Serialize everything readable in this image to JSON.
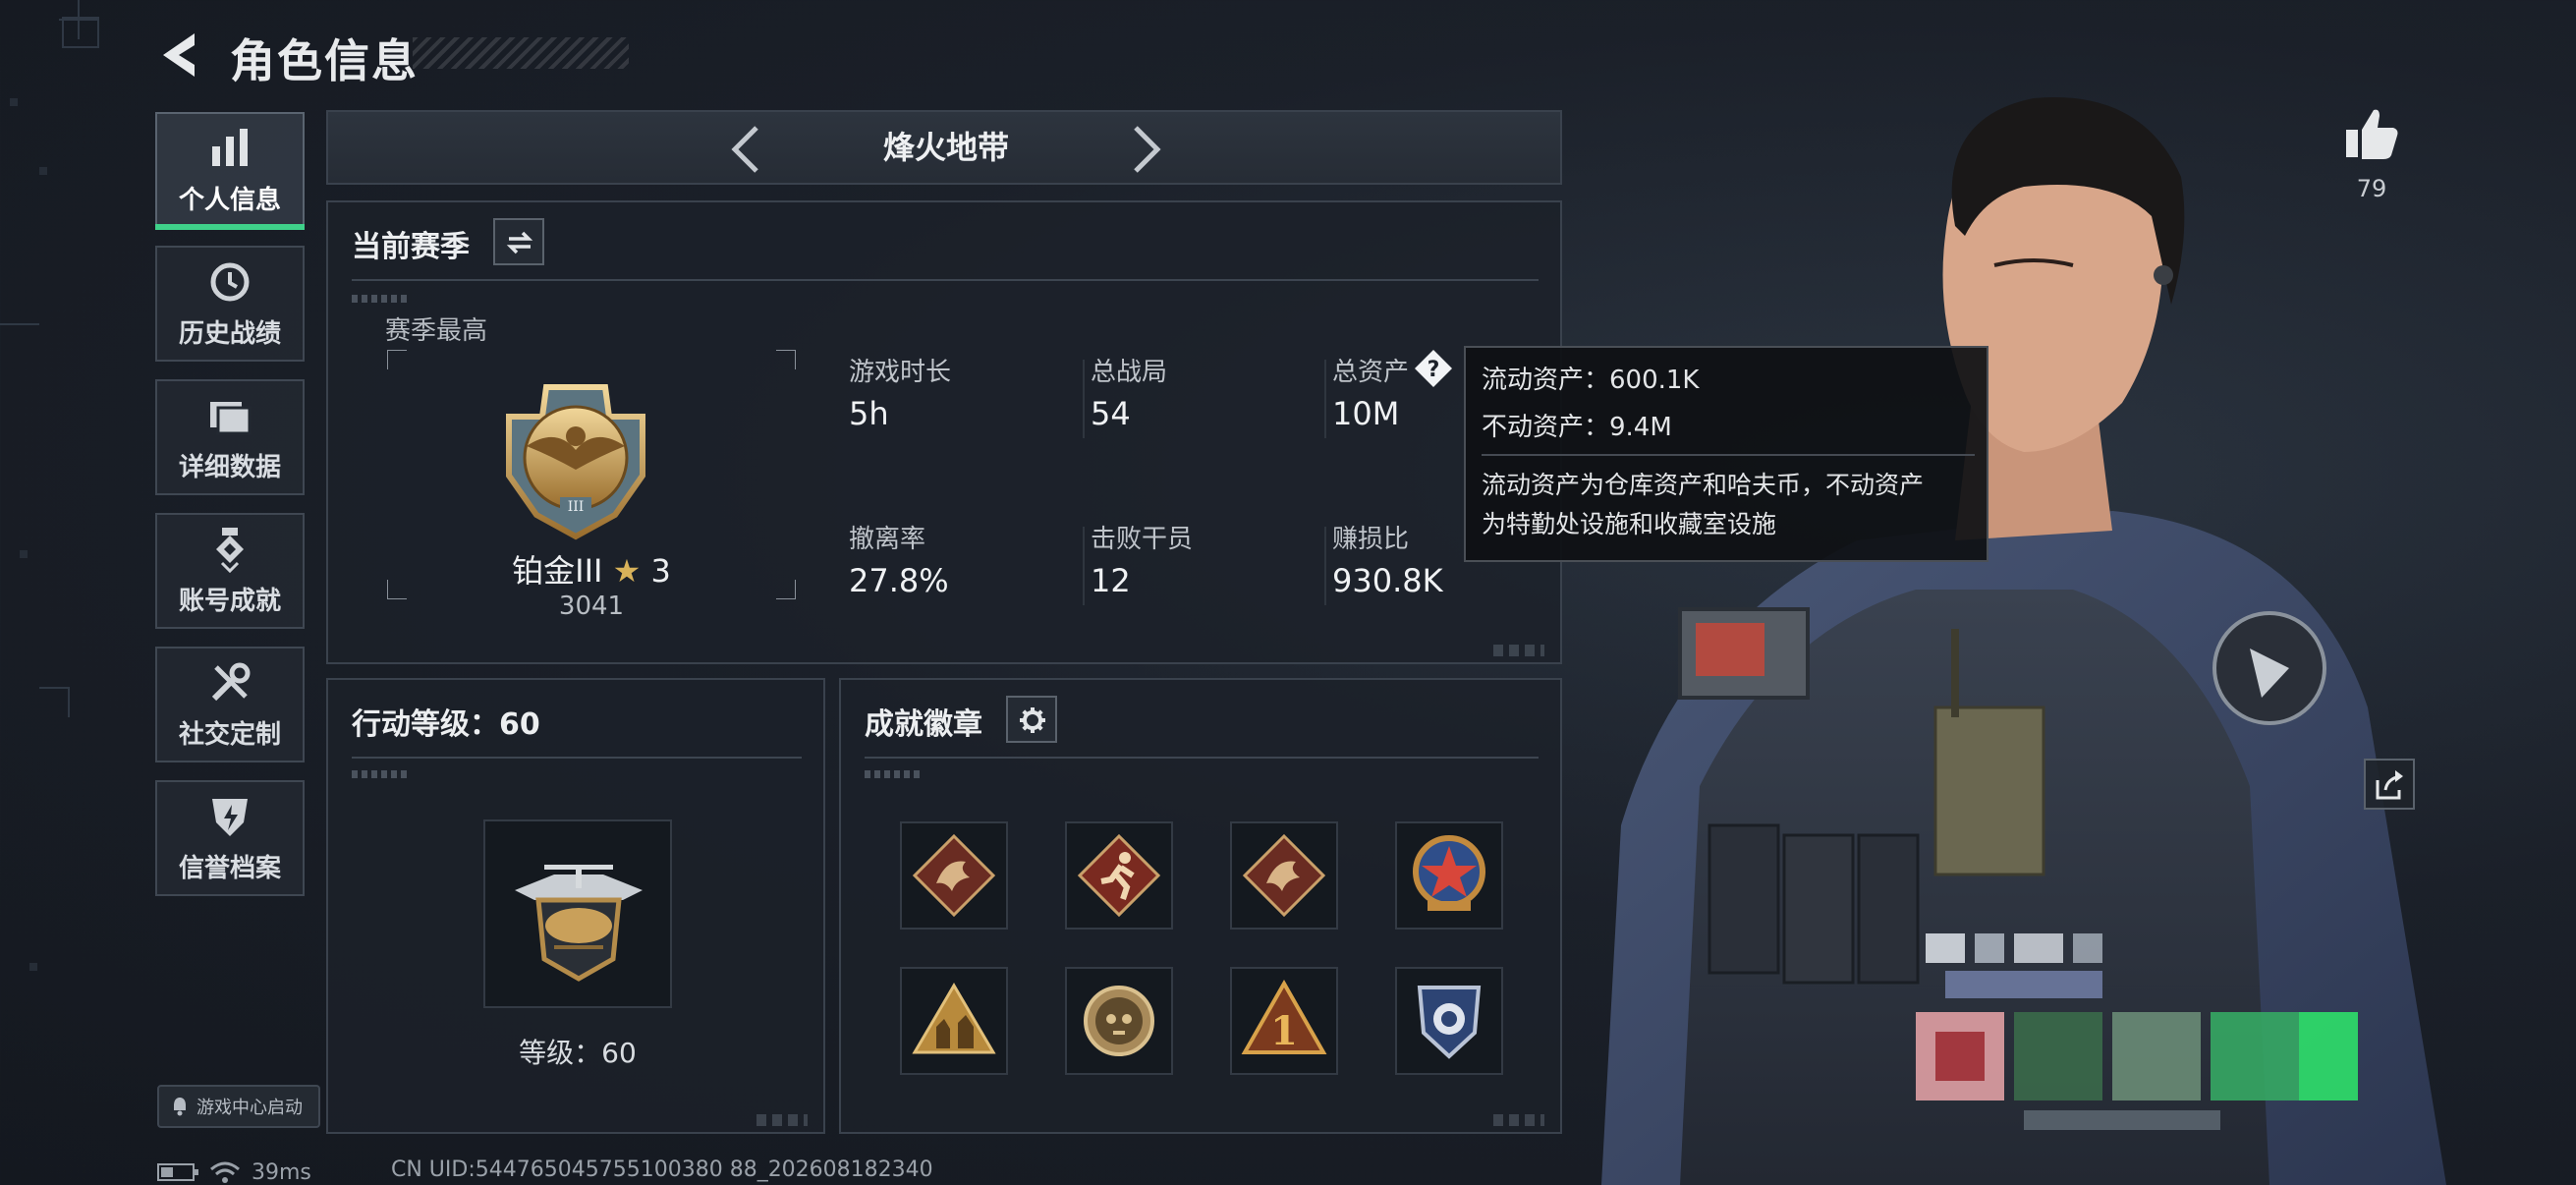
{
  "header": {
    "title": "角色信息"
  },
  "sidebar": {
    "items": [
      {
        "label": "个人信息",
        "icon": "bar-chart-icon"
      },
      {
        "label": "历史战绩",
        "icon": "history-clock-icon"
      },
      {
        "label": "详细数据",
        "icon": "folder-icon"
      },
      {
        "label": "账号成就",
        "icon": "medal-icon"
      },
      {
        "label": "社交定制",
        "icon": "wrench-screwdriver-icon"
      },
      {
        "label": "信誉档案",
        "icon": "shield-bolt-icon"
      }
    ],
    "game_center_label": "游戏中心启动"
  },
  "mode_selector": {
    "name": "烽火地带"
  },
  "season": {
    "title": "当前赛季",
    "best_label": "赛季最高",
    "rank_name": "铂金III",
    "rank_stars": "3",
    "rank_points": "3041",
    "stats": [
      {
        "label": "游戏时长",
        "value": "5h"
      },
      {
        "label": "总战局",
        "value": "54"
      },
      {
        "label": "总资产",
        "value": "10M"
      },
      {
        "label": "撤离率",
        "value": "27.8%"
      },
      {
        "label": "击败干员",
        "value": "12"
      },
      {
        "label": "赚损比",
        "value": "930.8K"
      }
    ]
  },
  "tooltip": {
    "liquid": "流动资产：600.1K",
    "fixed": "不动资产：9.4M",
    "note_line1": "流动资产为仓库资产和哈夫币，不动资产",
    "note_line2": "为特勤处设施和收藏室设施"
  },
  "action_level": {
    "title": "行动等级：60",
    "level_text": "等级：60"
  },
  "achievements": {
    "title": "成就徽章",
    "badges": [
      "dragon-badge-icon",
      "runner-badge-icon",
      "dragon-badge-icon",
      "star-emblem-badge-icon",
      "soldiers-triangle-badge-icon",
      "skull-coin-badge-icon",
      "number-one-badge-icon",
      "police-shield-badge-icon"
    ]
  },
  "profile": {
    "likes": "79"
  },
  "status": {
    "ping": "39ms",
    "uid": "CN UID:544765045755100380 88_202608182340"
  },
  "colors": {
    "accent_green": "#3fd18a",
    "panel_border": "#3a424d"
  }
}
